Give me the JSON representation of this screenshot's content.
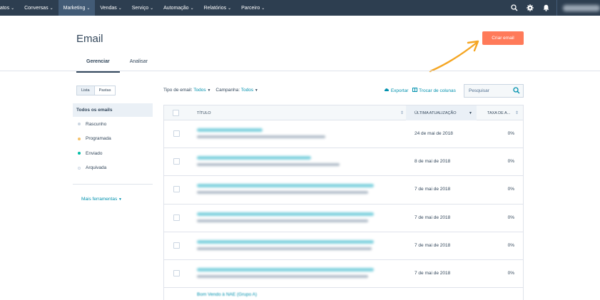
{
  "nav": {
    "items": [
      {
        "label": "ntatos",
        "chevron": true,
        "active": false
      },
      {
        "label": "Conversas",
        "chevron": true,
        "active": false
      },
      {
        "label": "Marketing",
        "chevron": true,
        "active": true
      },
      {
        "label": "Vendas",
        "chevron": true,
        "active": false
      },
      {
        "label": "Serviço",
        "chevron": true,
        "active": false
      },
      {
        "label": "Automação",
        "chevron": true,
        "active": false
      },
      {
        "label": "Relatórios",
        "chevron": true,
        "active": false
      },
      {
        "label": "Parceiro",
        "chevron": true,
        "active": false
      }
    ],
    "chevron_glyph": "⌄",
    "icons": [
      "search-icon",
      "gear-icon",
      "bell-icon"
    ]
  },
  "header": {
    "title": "Email",
    "create_button": "Criar email"
  },
  "tabs": [
    {
      "label": "Gerenciar",
      "active": true
    },
    {
      "label": "Analisar",
      "active": false
    }
  ],
  "sidebar": {
    "view_toggle": [
      "Lista",
      "Pastas"
    ],
    "items": [
      {
        "label": "Todos os emails",
        "dot": null
      },
      {
        "label": "Rascunho",
        "dot": "#cbd6e2"
      },
      {
        "label": "Programada",
        "dot": "#f5c26b"
      },
      {
        "label": "Enviado",
        "dot": "#00bda5"
      },
      {
        "label": "Arquivada",
        "dot": "hollow"
      }
    ],
    "more_tools": "Mais ferramentas"
  },
  "filters": {
    "type_label": "Tipo de email:",
    "type_value": "Todos",
    "campaign_label": "Campanha:",
    "campaign_value": "Todos"
  },
  "actions": {
    "export": "Exportar",
    "columns": "Trocar de colunas"
  },
  "search": {
    "placeholder": "Pesquisar"
  },
  "table": {
    "columns": [
      "TÍTULO",
      "ÚLTIMA ATUALIZAÇÃO",
      "TAXA DE A..."
    ],
    "rows": [
      {
        "date": "24 de mai de 2018",
        "rate": "0%"
      },
      {
        "date": "8 de mai de 2018",
        "rate": "0%"
      },
      {
        "date": "7 de mai de 2018",
        "rate": "0%"
      },
      {
        "date": "7 de mai de 2018",
        "rate": "0%"
      },
      {
        "date": "7 de mai de 2018",
        "rate": "0%"
      },
      {
        "date": "7 de mai de 2018",
        "rate": "0%"
      }
    ],
    "partial_row_title": "Bom Vendo à NAE (Grupo A)"
  },
  "colors": {
    "nav_bg": "#2d3e50",
    "accent": "#ff7a59",
    "link": "#0091ae",
    "text": "#33475b"
  }
}
